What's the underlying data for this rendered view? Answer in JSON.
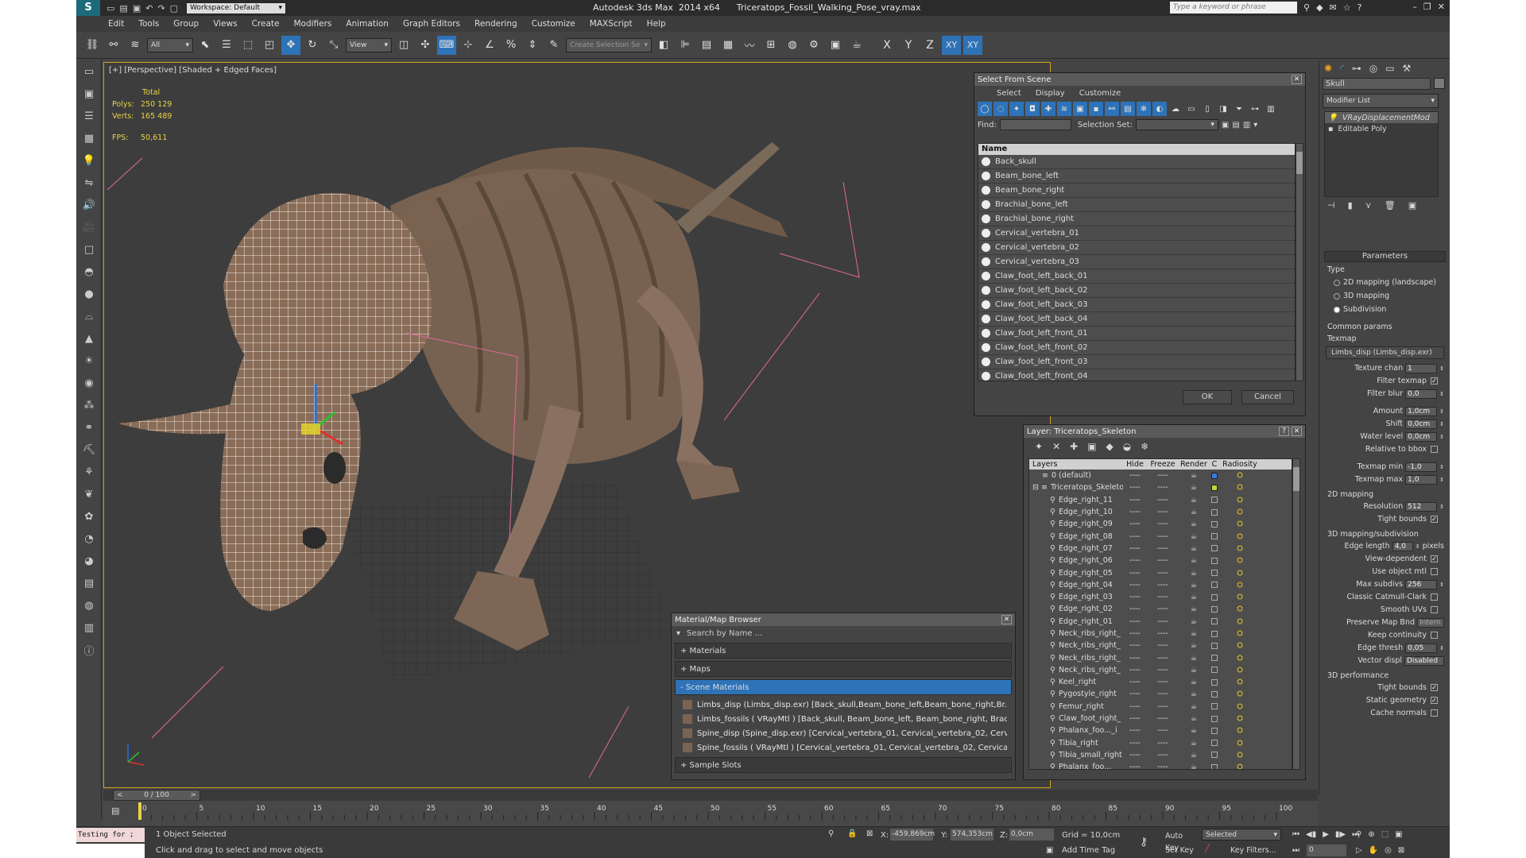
{
  "title_bar": {
    "workspace_label": "Workspace: Default",
    "app_title": "Autodesk 3ds Max  2014 x64      Triceratops_Fossil_Walking_Pose_vray.max",
    "search_placeholder": "Type a keyword or phrase"
  },
  "menu": [
    "Edit",
    "Tools",
    "Group",
    "Views",
    "Create",
    "Modifiers",
    "Animation",
    "Graph Editors",
    "Rendering",
    "Customize",
    "MAXScript",
    "Help"
  ],
  "toolbar": {
    "filter_value": "All",
    "view_value": "View",
    "selection_set_placeholder": "Create Selection Se",
    "axis_labels": [
      "X",
      "Y",
      "Z",
      "XY",
      "XY"
    ]
  },
  "viewport": {
    "label": "[+] [Perspective] [Shaded + Edged Faces]",
    "stats": {
      "total_label": "Total",
      "polys_label": "Polys:",
      "polys_value": "250 129",
      "verts_label": "Verts:",
      "verts_value": "165 489",
      "fps_label": "FPS:",
      "fps_value": "50,611"
    }
  },
  "select_from_scene": {
    "title": "Select From Scene",
    "tabs": [
      "Select",
      "Display",
      "Customize"
    ],
    "find_label": "Find:",
    "selection_set_label": "Selection Set:",
    "column_name": "Name",
    "items": [
      "Back_skull",
      "Beam_bone_left",
      "Beam_bone_right",
      "Brachial_bone_left",
      "Brachial_bone_right",
      "Cervical_vertebra_01",
      "Cervical_vertebra_02",
      "Cervical_vertebra_03",
      "Claw_foot_left_back_01",
      "Claw_foot_left_back_02",
      "Claw_foot_left_back_03",
      "Claw_foot_left_back_04",
      "Claw_foot_left_front_01",
      "Claw_foot_left_front_02",
      "Claw_foot_left_front_03",
      "Claw_foot_left_front_04"
    ],
    "ok_label": "OK",
    "cancel_label": "Cancel"
  },
  "layer_window": {
    "title": "Layer: Triceratops_Skeleton",
    "columns": [
      "Layers",
      "Hide",
      "Freeze",
      "Render",
      "C",
      "Radiosity"
    ],
    "layers": [
      "0 (default)",
      "Triceratops_Skeleto"
    ],
    "objects": [
      "Edge_right_11",
      "Edge_right_10",
      "Edge_right_09",
      "Edge_right_08",
      "Edge_right_07",
      "Edge_right_06",
      "Edge_right_05",
      "Edge_right_04",
      "Edge_right_03",
      "Edge_right_02",
      "Edge_right_01",
      "Neck_ribs_right_",
      "Neck_ribs_right_",
      "Neck_ribs_right_",
      "Neck_ribs_right_",
      "Keel_right",
      "Pygostyle_right",
      "Femur_right",
      "Claw_foot_right_",
      "Phalanx_foo..._i",
      "Tibia_right",
      "Tibia_small_right",
      "Phalanx_foo..."
    ],
    "dash": "----"
  },
  "material_browser": {
    "title": "Material/Map Browser",
    "search_placeholder": "Search by Name ...",
    "sections": [
      "+ Materials",
      "+ Maps",
      "- Scene Materials",
      "+ Sample Slots"
    ],
    "materials": [
      "Limbs_disp (Limbs_disp.exr) [Back_skull,Beam_bone_left,Beam_bone_right,Br...",
      "Limbs_fossils  ( VRayMtl ) [Back_skull, Beam_bone_left, Beam_bone_right, Brac...",
      "Spine_disp (Spine_disp.exr) [Cervical_vertebra_01, Cervical_vertebra_02, Cervic...",
      "Spine_fossils  ( VRayMtl ) [Cervical_vertebra_01, Cervical_vertebra_02, Cervical_..."
    ]
  },
  "command_panel": {
    "object_name": "Skull",
    "modifier_list_label": "Modifier List",
    "stack": [
      "VRayDisplacementMod",
      "Editable Poly"
    ],
    "rollout_title": "Parameters",
    "type_label": "Type",
    "type_options": [
      "2D mapping (landscape)",
      "3D mapping",
      "Subdivision"
    ],
    "common_params_label": "Common params",
    "texmap_label": "Texmap",
    "texmap_value": "Limbs_disp (Limbs_disp.exr)",
    "texture_chan_label": "Texture chan",
    "texture_chan_value": "1",
    "filter_texmap_label": "Filter texmap",
    "filter_blur_label": "Filter blur",
    "filter_blur_value": "0,0",
    "amount_label": "Amount",
    "amount_value": "1,0cm",
    "shift_label": "Shift",
    "shift_value": "0,0cm",
    "water_level_label": "Water level",
    "water_level_value": "0,0cm",
    "relative_bbox_label": "Relative to bbox",
    "texmap_min_label": "Texmap min",
    "texmap_min_value": "-1,0",
    "texmap_max_label": "Texmap max",
    "texmap_max_value": "1,0",
    "mapping2d_label": "2D mapping",
    "resolution_label": "Resolution",
    "resolution_value": "512",
    "tight_bounds_label": "Tight bounds",
    "mapping3d_label": "3D mapping/subdivision",
    "edge_length_label": "Edge length",
    "edge_length_value": "4,0",
    "pixels_label": "pixels",
    "view_dependent_label": "View-dependent",
    "use_object_mtl_label": "Use object mtl",
    "max_subdivs_label": "Max subdivs",
    "max_subdivs_value": "256",
    "classic_catmull_label": "Classic Catmull-Clark",
    "smooth_uvs_label": "Smooth UVs",
    "preserve_map_bnd_label": "Preserve Map Bnd",
    "preserve_map_bnd_value": "Intern",
    "keep_continuity_label": "Keep continuity",
    "edge_thresh_label": "Edge thresh",
    "edge_thresh_value": "0,05",
    "vector_displ_label": "Vector displ",
    "vector_displ_value": "Disabled",
    "performance_label": "3D performance",
    "static_geometry_label": "Static geometry",
    "cache_normals_label": "Cache normals"
  },
  "timeline": {
    "frame_label": "0 / 100",
    "ticks": [
      "0",
      "5",
      "10",
      "15",
      "20",
      "25",
      "30",
      "35",
      "40",
      "45",
      "50",
      "55",
      "60",
      "65",
      "70",
      "75",
      "80",
      "85",
      "90",
      "95",
      "100"
    ]
  },
  "status": {
    "maxscript_text": "Testing for ;",
    "selection_text": "1 Object Selected",
    "prompt_text": "Click and drag to select and move objects",
    "x_label": "X:",
    "x_value": "-459,869cm",
    "y_label": "Y:",
    "y_value": "574,353cm",
    "z_label": "Z:",
    "z_value": "0,0cm",
    "grid_text": "Grid = 10,0cm",
    "add_time_tag": "Add Time Tag",
    "auto_key": "Auto Key",
    "set_key": "Set Key",
    "selected_value": "Selected",
    "key_filters": "Key Filters...",
    "frame_value": "0"
  },
  "colors": {
    "accent": "#2e73b8",
    "viewport_border": "#d8a11a",
    "layer_color_blue": "#3a78d8",
    "layer_color_green": "#b8d83a"
  }
}
